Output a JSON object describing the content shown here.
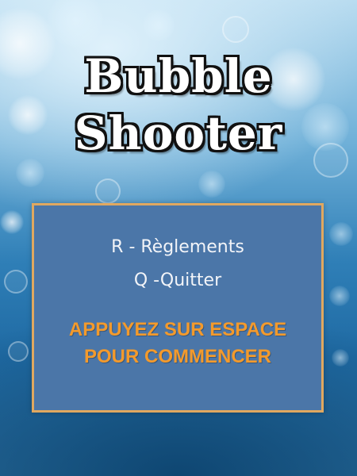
{
  "title": {
    "line1": "Bubble",
    "line2": "Shooter"
  },
  "menu": {
    "rules_option": "R - Règlements",
    "quit_option": "Q -Quitter",
    "start_prompt_line1": "APPUYEZ SUR ESPACE",
    "start_prompt_line2": "POUR COMMENCER"
  },
  "colors": {
    "panel_background": "#4b76a8",
    "panel_border": "#e0a860",
    "prompt_text": "#f39a2c",
    "option_text": "#f2f4f8",
    "title_fill": "#ffffff",
    "title_outline": "#111111"
  },
  "background": {
    "style": "blue bokeh bubbles"
  }
}
